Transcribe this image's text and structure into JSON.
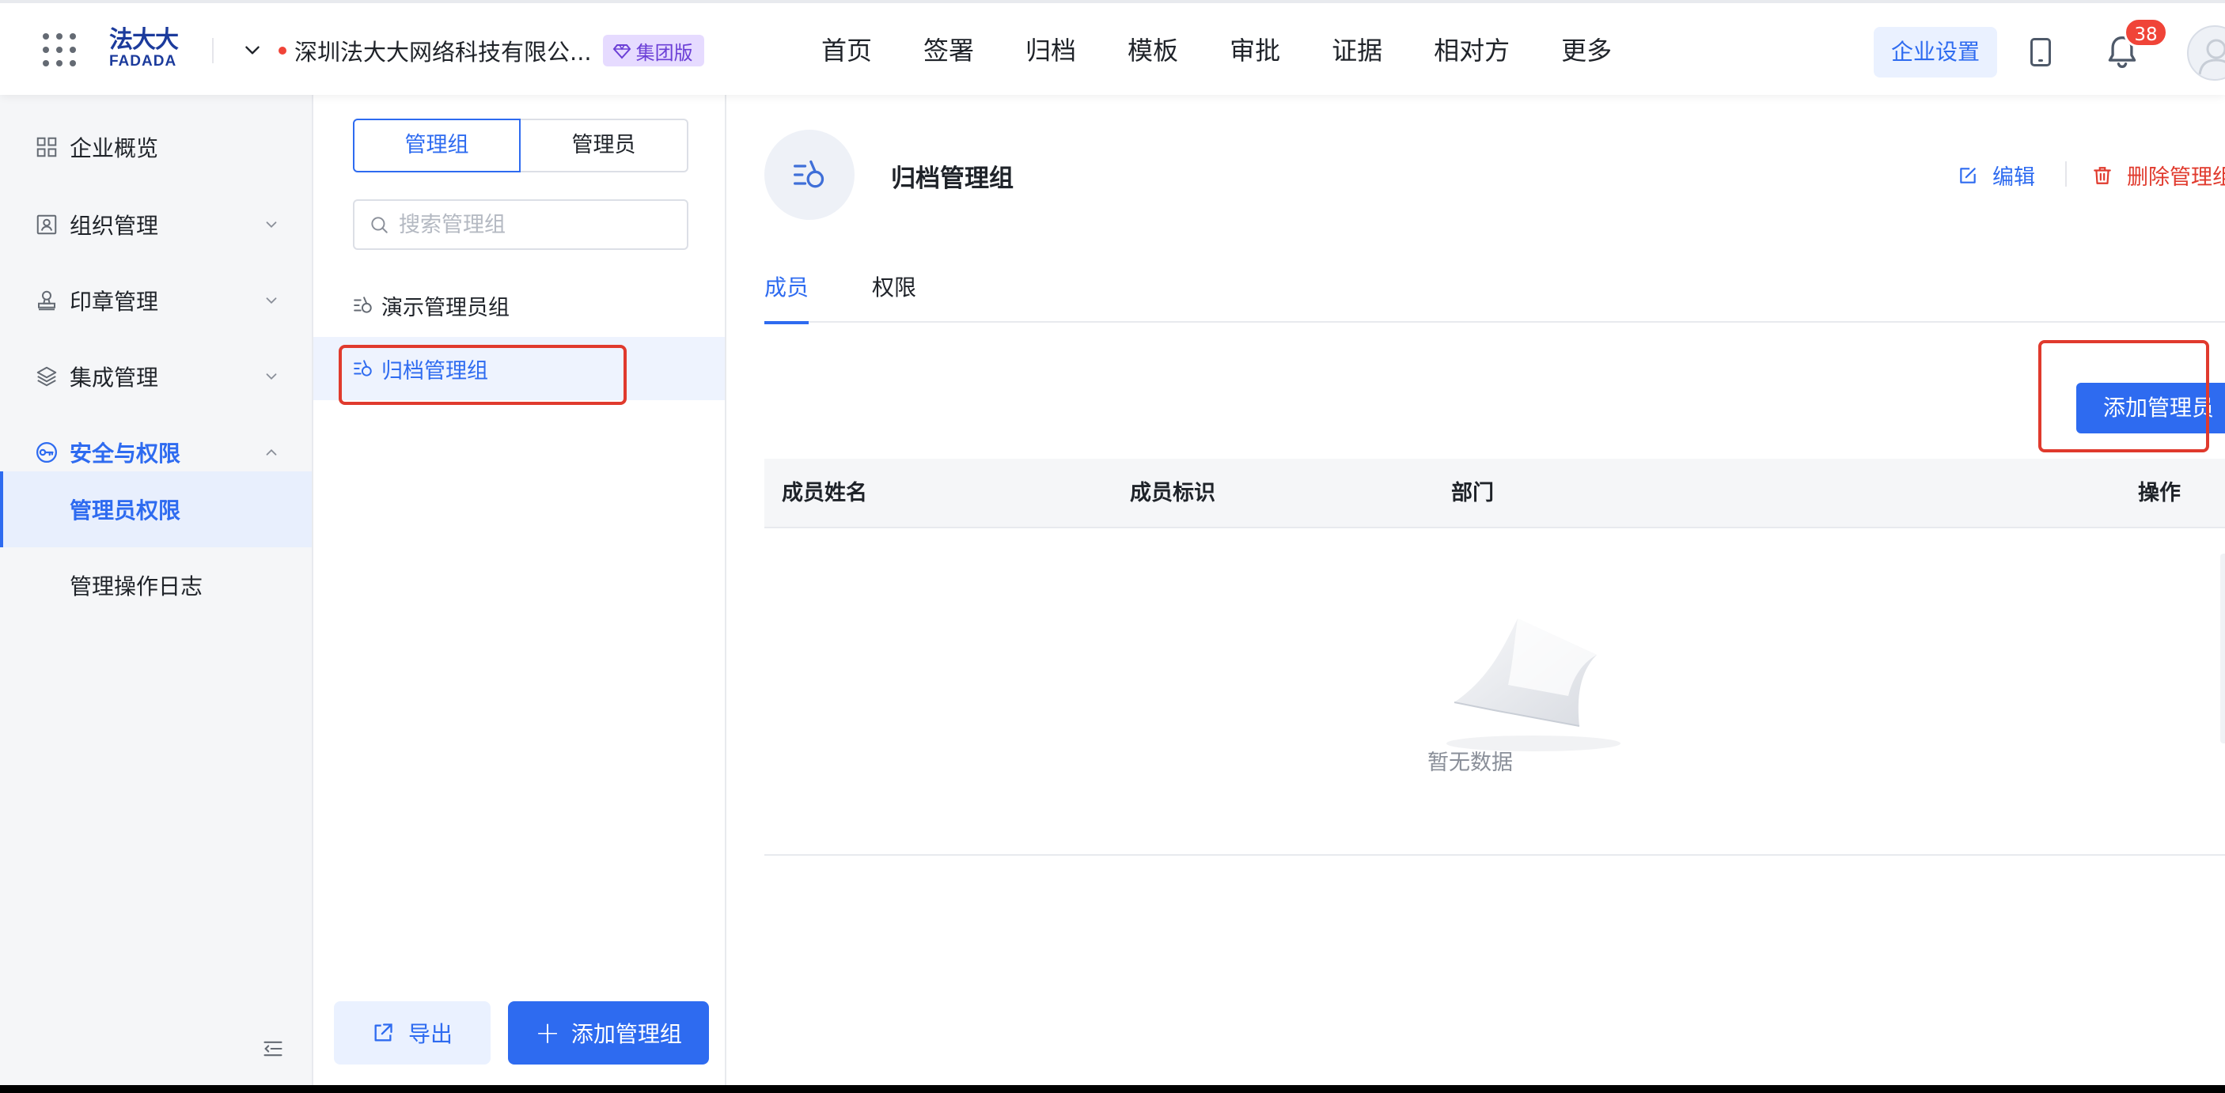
{
  "header": {
    "logo_cn": "法大大",
    "logo_en": "FADADA",
    "company_name": "深圳法大大网络科技有限公...",
    "edition_badge": "集团版",
    "nav": [
      "首页",
      "签署",
      "归档",
      "模板",
      "审批",
      "证据",
      "相对方",
      "更多"
    ],
    "enterprise_settings": "企业设置",
    "notification_count": "38"
  },
  "sidebar": {
    "items": [
      {
        "label": "企业概览",
        "icon": "overview-icon"
      },
      {
        "label": "组织管理",
        "icon": "org-icon"
      },
      {
        "label": "印章管理",
        "icon": "seal-icon"
      },
      {
        "label": "集成管理",
        "icon": "layers-icon"
      },
      {
        "label": "安全与权限",
        "icon": "key-icon"
      }
    ],
    "subitems": [
      "管理员权限",
      "管理操作日志"
    ]
  },
  "panel": {
    "tabs": [
      "管理组",
      "管理员"
    ],
    "search_placeholder": "搜索管理组",
    "groups": [
      "演示管理员组",
      "归档管理组"
    ],
    "export_label": "导出",
    "add_group_label": "添加管理组"
  },
  "detail": {
    "title": "归档管理组",
    "edit_label": "编辑",
    "delete_label": "删除管理组",
    "tabs": [
      "成员",
      "权限"
    ],
    "add_admin_label": "添加管理员",
    "columns": [
      "成员姓名",
      "成员标识",
      "部门",
      "操作"
    ],
    "empty_text": "暂无数据"
  },
  "colors": {
    "primary": "#2e6bf0",
    "danger": "#e03a2d",
    "badge_purple": "#6b3fd6"
  }
}
